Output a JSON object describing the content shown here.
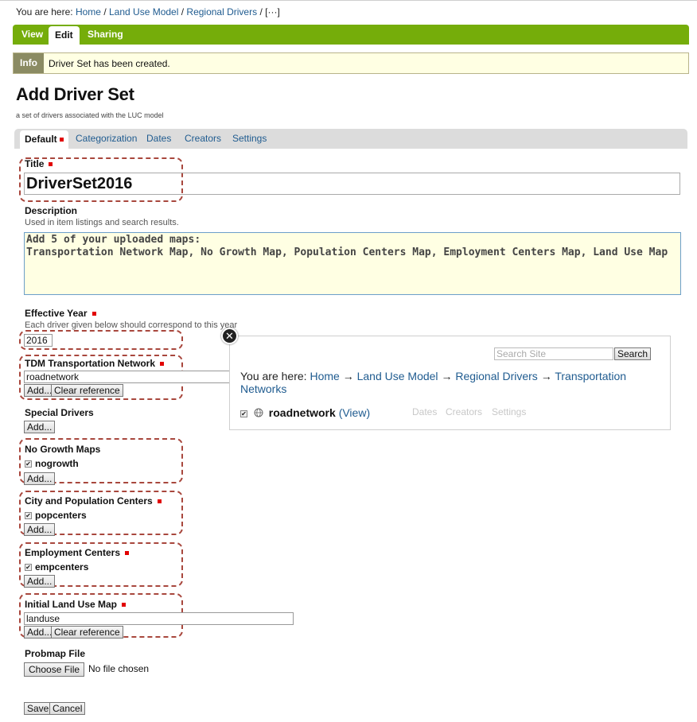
{
  "breadcrumb": {
    "prefix": "You are here:",
    "items": [
      "Home",
      "Land Use Model",
      "Regional Drivers"
    ],
    "ellipsis": "[···]"
  },
  "editbar": {
    "tabs": [
      "View",
      "Edit",
      "Sharing"
    ],
    "active": "Edit"
  },
  "message": {
    "label": "Info",
    "text": "Driver Set has been created."
  },
  "page": {
    "title": "Add Driver Set",
    "description": "a set of drivers associated with the LUC model"
  },
  "form_tabs": [
    "Default",
    "Categorization",
    "Dates",
    "Creators",
    "Settings"
  ],
  "fields": {
    "title": {
      "label": "Title",
      "value": "DriverSet2016"
    },
    "description": {
      "label": "Description",
      "help": "Used in item listings and search results.",
      "value": "Add 5 of your uploaded maps:\nTransportation Network Map, No Growth Map, Population Centers Map, Employment Centers Map, Land Use Map"
    },
    "effective_year": {
      "label": "Effective Year",
      "help": "Each driver given below should correspond to this year",
      "value": "2016"
    },
    "tdm": {
      "label": "TDM Transportation Network",
      "value": "roadnetwork"
    },
    "special": {
      "label": "Special Drivers"
    },
    "nogrowth": {
      "label": "No Growth Maps",
      "item": "nogrowth"
    },
    "popcenters": {
      "label": "City and Population Centers",
      "item": "popcenters"
    },
    "empcenters": {
      "label": "Employment Centers",
      "item": "empcenters"
    },
    "landuse": {
      "label": "Initial Land Use Map",
      "value": "landuse"
    },
    "probmap": {
      "label": "Probmap File",
      "choose": "Choose File",
      "none": "No file chosen"
    }
  },
  "buttons": {
    "add": "Add...",
    "clear": "Clear reference",
    "save": "Save",
    "cancel": "Cancel"
  },
  "popup": {
    "search_placeholder": "Search Site",
    "search_button": "Search",
    "crumb_prefix": "You are here:",
    "crumb": [
      "Home",
      "Land Use Model",
      "Regional Drivers",
      "Transportation Networks"
    ],
    "item": "roadnetwork",
    "view": "(View)"
  },
  "colors": {
    "editbar": "#75ad0a",
    "required": "#e10000",
    "highlight": "#a8473d",
    "link": "#205c90"
  }
}
